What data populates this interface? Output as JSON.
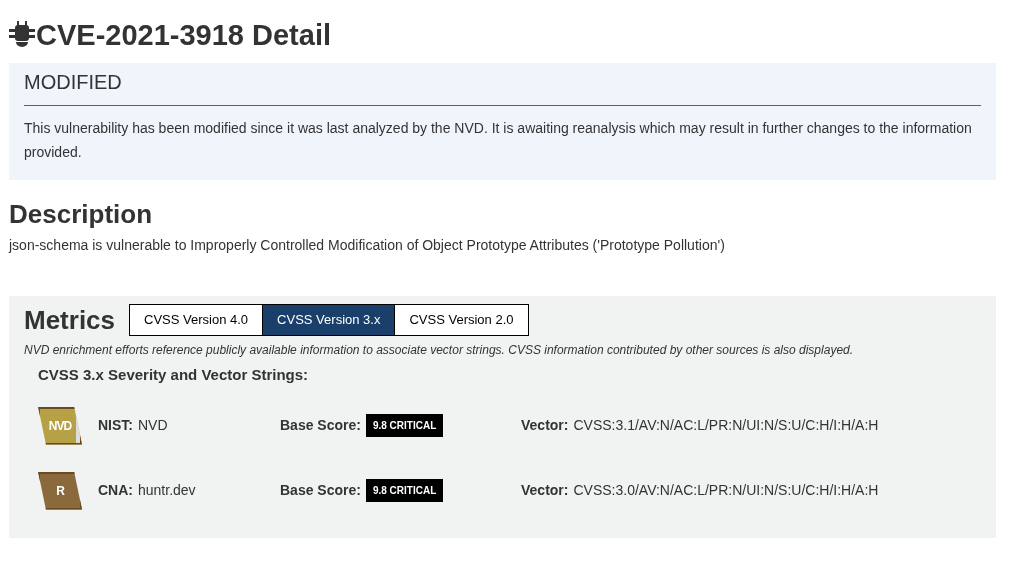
{
  "page_title": "CVE-2021-3918 Detail",
  "notice": {
    "status": "MODIFIED",
    "text": "This vulnerability has been modified since it was last analyzed by the NVD. It is awaiting reanalysis which may result in further changes to the information provided."
  },
  "description": {
    "heading": "Description",
    "text": "json-schema is vulnerable to Improperly Controlled Modification of Object Prototype Attributes ('Prototype Pollution')"
  },
  "metrics": {
    "heading": "Metrics",
    "tabs": [
      {
        "label": "CVSS Version 4.0",
        "selected": false
      },
      {
        "label": "CVSS Version 3.x",
        "selected": true
      },
      {
        "label": "CVSS Version 2.0",
        "selected": false
      }
    ],
    "note": "NVD enrichment efforts reference publicly available information to associate vector strings. CVSS information contributed by other sources is also displayed.",
    "subheading": "CVSS 3.x Severity and Vector Strings:",
    "rows": [
      {
        "kind": "nist",
        "logo_text": "NVD",
        "source_label": "NIST:",
        "source": "NVD",
        "score_label": "Base Score:",
        "score": "9.8 CRITICAL",
        "vector_label": "Vector:",
        "vector": "CVSS:3.1/AV:N/AC:L/PR:N/UI:N/S:U/C:H/I:H/A:H"
      },
      {
        "kind": "cna",
        "logo_text": "R",
        "source_label": "CNA:",
        "source": "huntr.dev",
        "score_label": "Base Score:",
        "score": "9.8 CRITICAL",
        "vector_label": "Vector:",
        "vector": "CVSS:3.0/AV:N/AC:L/PR:N/UI:N/S:U/C:H/I:H/A:H"
      }
    ]
  }
}
